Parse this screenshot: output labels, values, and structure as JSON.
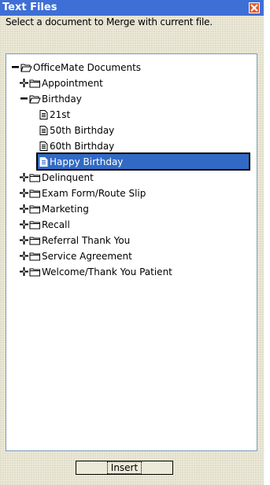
{
  "window": {
    "title": "Text Files",
    "close_icon": "close-icon",
    "accent": "#3e6fd6"
  },
  "prompt": "Select a document to Merge with current file.",
  "tree": {
    "root": {
      "label": "OfficeMate Documents",
      "state": "expanded"
    },
    "children": [
      {
        "label": "Appointment",
        "state": "collapsed"
      },
      {
        "label": "Birthday",
        "state": "expanded",
        "items": [
          {
            "label": "21st"
          },
          {
            "label": "50th Birthday"
          },
          {
            "label": "60th Birthday"
          },
          {
            "label": "Happy Birthday",
            "selected": true
          }
        ]
      },
      {
        "label": "Delinquent",
        "state": "collapsed"
      },
      {
        "label": "Exam Form/Route Slip",
        "state": "collapsed"
      },
      {
        "label": "Marketing",
        "state": "collapsed"
      },
      {
        "label": "Recall",
        "state": "collapsed"
      },
      {
        "label": "Referral Thank You",
        "state": "collapsed"
      },
      {
        "label": "Service Agreement",
        "state": "collapsed"
      },
      {
        "label": "Welcome/Thank You Patient",
        "state": "collapsed"
      }
    ]
  },
  "selection_color": "#316ac5",
  "insert_button": "Insert"
}
